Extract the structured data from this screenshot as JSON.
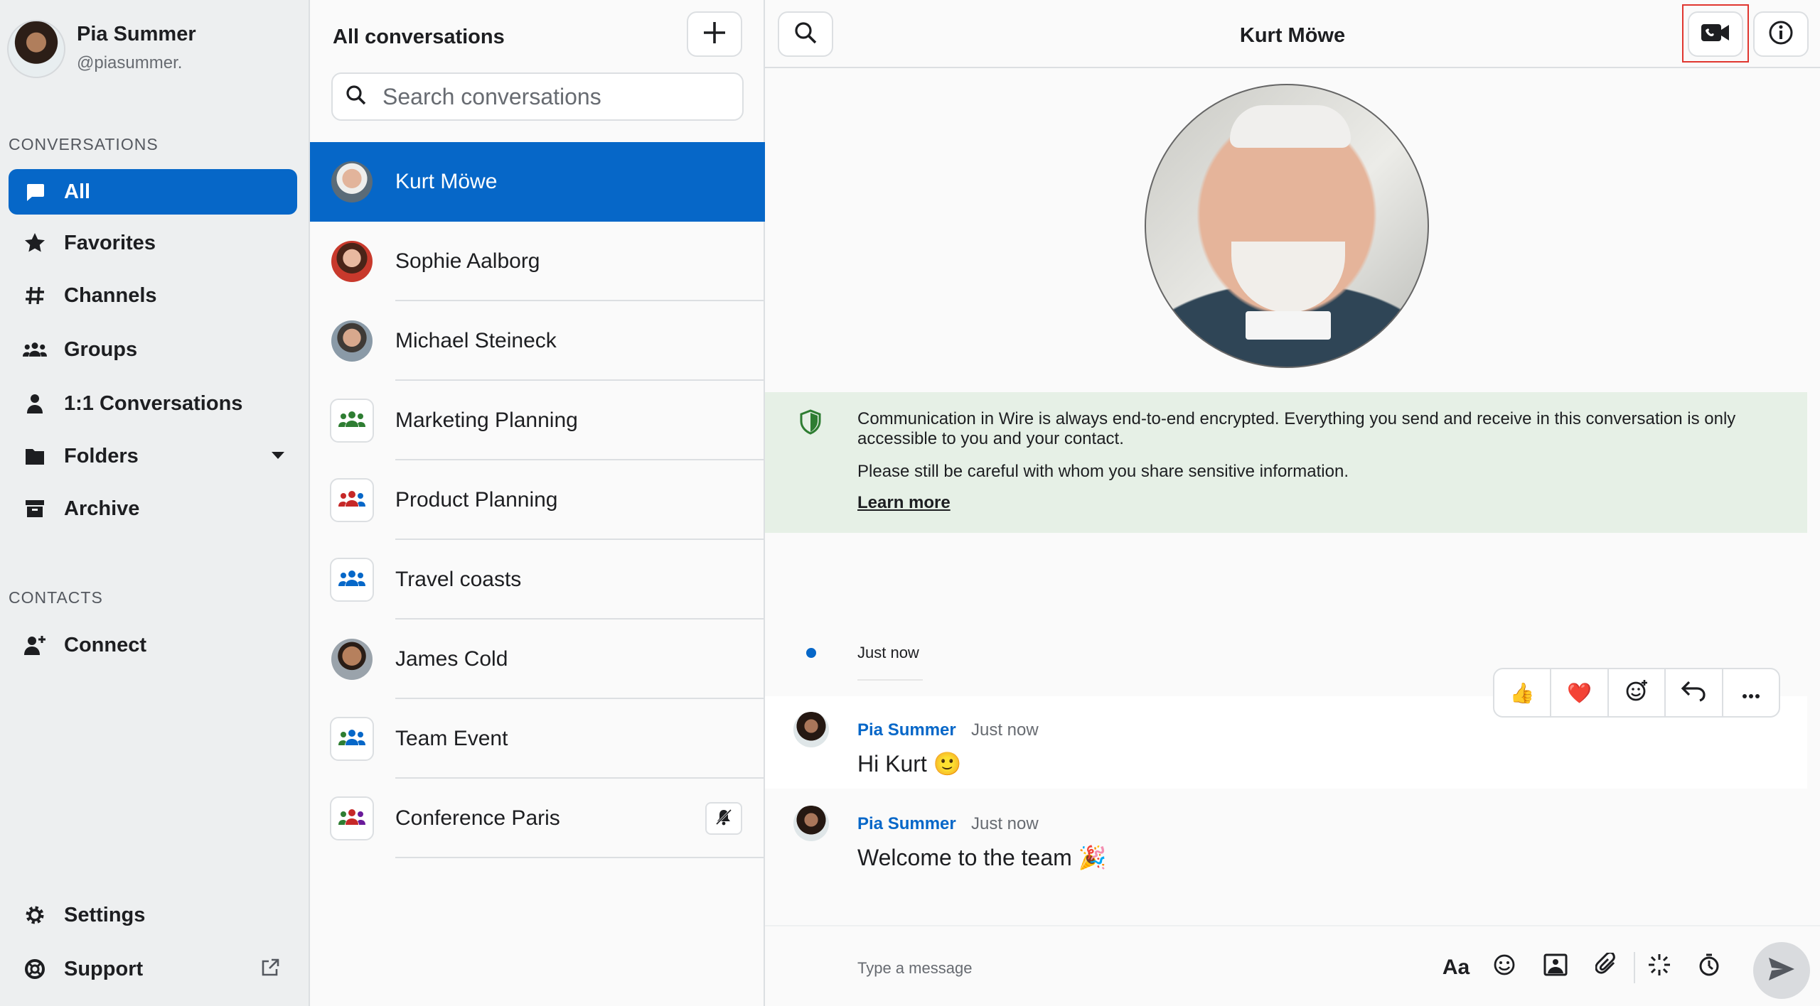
{
  "profile": {
    "name": "Pia Summer",
    "handle": "@piasummer."
  },
  "sidebar": {
    "conversations_title": "CONVERSATIONS",
    "items": [
      {
        "label": "All",
        "icon": "chat-bubble-icon"
      },
      {
        "label": "Favorites",
        "icon": "star-icon"
      },
      {
        "label": "Channels",
        "icon": "hash-icon"
      },
      {
        "label": "Groups",
        "icon": "group-icon"
      },
      {
        "label": "1:1 Conversations",
        "icon": "person-icon"
      },
      {
        "label": "Folders",
        "icon": "folder-icon"
      },
      {
        "label": "Archive",
        "icon": "archive-icon"
      }
    ],
    "contacts_title": "CONTACTS",
    "connect_label": "Connect",
    "settings_label": "Settings",
    "support_label": "Support"
  },
  "convlist": {
    "title": "All conversations",
    "search_placeholder": "Search conversations",
    "items": [
      {
        "name": "Kurt Möwe",
        "type": "person",
        "active": true
      },
      {
        "name": "Sophie Aalborg",
        "type": "person"
      },
      {
        "name": "Michael Steineck",
        "type": "person"
      },
      {
        "name": "Marketing Planning",
        "type": "group"
      },
      {
        "name": "Product Planning",
        "type": "group"
      },
      {
        "name": "Travel coasts",
        "type": "group"
      },
      {
        "name": "James Cold",
        "type": "person"
      },
      {
        "name": "Team Event",
        "type": "group"
      },
      {
        "name": "Conference Paris",
        "type": "group",
        "muted": true
      }
    ]
  },
  "conversation": {
    "title": "Kurt Möwe",
    "e2e": {
      "line1": "Communication in Wire is always end-to-end encrypted. Everything you send and receive in this conversation is only accessible to you and your contact.",
      "line2": "Please still be careful with whom you share sensitive information.",
      "link": "Learn more"
    },
    "timeline_label": "Just now",
    "messages": [
      {
        "sender": "Pia Summer",
        "time": "Just now",
        "text": "Hi Kurt 🙂"
      },
      {
        "sender": "Pia Summer",
        "time": "Just now",
        "text": "Welcome to the team 🎉"
      }
    ],
    "reactions": [
      "👍",
      "❤️"
    ],
    "input_placeholder": "Type a message",
    "format_label": "Aa"
  },
  "colors": {
    "accent": "#0667c8",
    "e2e_bg": "#e6f0e6",
    "highlight": "#e0362f",
    "shield": "#2e7d32"
  }
}
